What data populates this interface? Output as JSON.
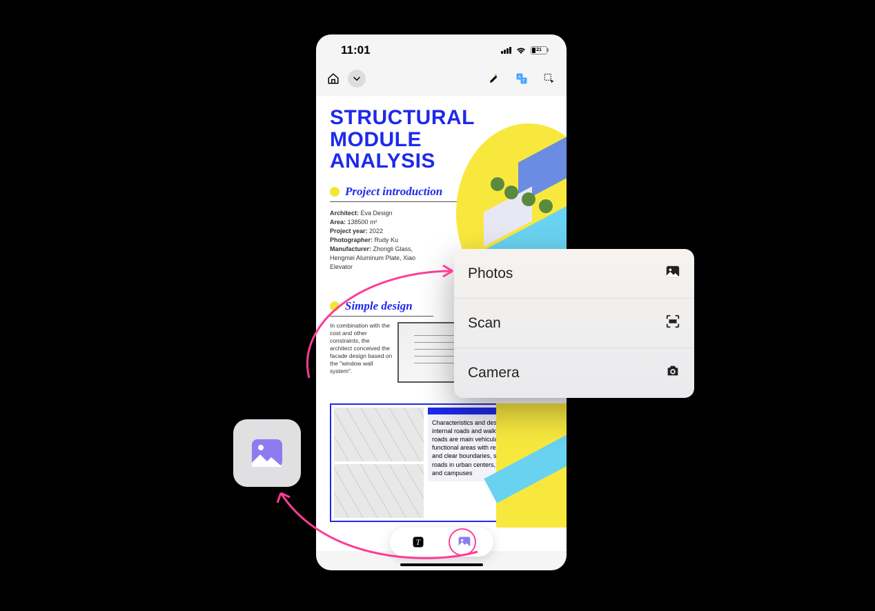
{
  "status": {
    "time": "11:01",
    "battery_pct": "21"
  },
  "toolbar": {
    "home_icon": "home-icon",
    "dropdown_icon": "chevron-down-icon",
    "highlighter_icon": "highlighter-icon",
    "translate_icon": "translate-icon",
    "select_icon": "selection-tool-icon"
  },
  "doc": {
    "title_line1": "STRUCTURAL MODULE",
    "title_line2": "ANALYSIS",
    "section1_title": "Project introduction",
    "meta": {
      "architect_k": "Architect:",
      "architect_v": " Eva Design",
      "area_k": "Area:",
      "area_v": " 138500 m²",
      "year_k": "Project year:",
      "year_v": " 2022",
      "photo_k": "Photographer:",
      "photo_v": " Rudy Ku",
      "manu_k": "Manufacturer:",
      "manu_v": " Zhongli Glass, Hengmei Aluminum Plate, Xiao Elevator"
    },
    "section2_title": "Simple design",
    "simple_text": "In combination with the cost and other constraints, the architect conceived the facade design based on the \"window wall system\".",
    "lower_text": "Characteristics and design points of internal roads and walkways Internal roads are main vehicular roads in functional areas with relatively complete and clear boundaries, such as main roads in urban centers, residential areas and campuses"
  },
  "bottom_pill": {
    "text_icon": "text-tool-icon",
    "image_icon": "image-tool-icon"
  },
  "popup": {
    "items": [
      {
        "label": "Photos",
        "icon": "photo-icon"
      },
      {
        "label": "Scan",
        "icon": "scan-icon"
      },
      {
        "label": "Camera",
        "icon": "camera-icon"
      }
    ]
  },
  "colors": {
    "accent_blue": "#1f29ec",
    "pink": "#ff3c96",
    "violet": "#8d7cf0",
    "yellow": "#f2e735"
  }
}
